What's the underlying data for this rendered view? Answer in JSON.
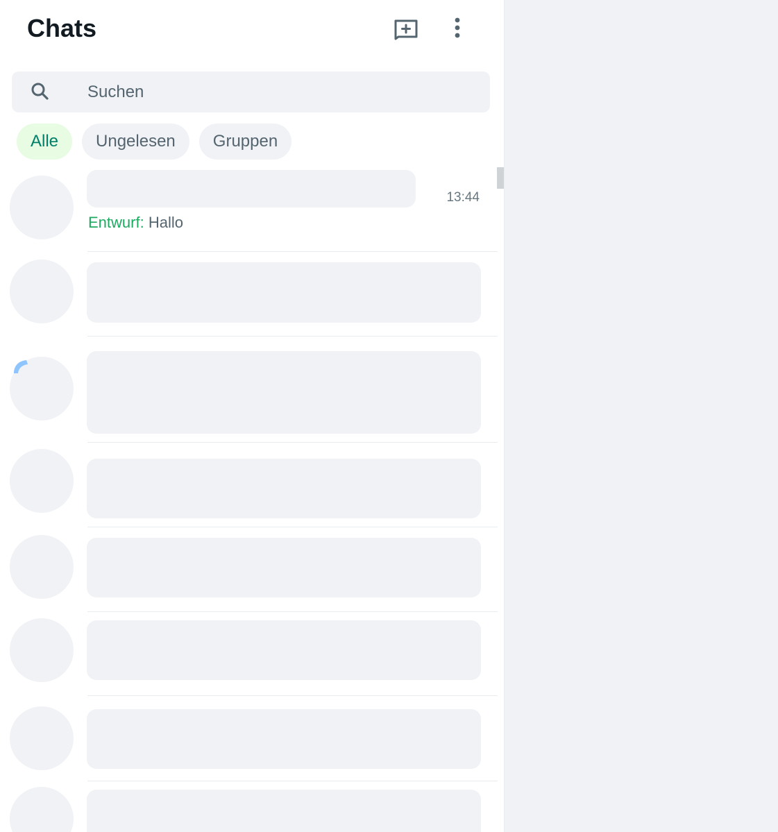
{
  "header": {
    "title": "Chats",
    "new_chat_icon": "new-chat-icon",
    "menu_icon": "more-vertical-icon"
  },
  "search": {
    "placeholder": "Suchen",
    "value": "",
    "icon": "search-icon"
  },
  "filters": [
    {
      "label": "Alle",
      "active": true
    },
    {
      "label": "Ungelesen",
      "active": false
    },
    {
      "label": "Gruppen",
      "active": false
    }
  ],
  "chats": [
    {
      "time": "13:44",
      "draft_label": "Entwurf:",
      "preview": " Hallo"
    }
  ],
  "colors": {
    "accent": "#008069",
    "draft": "#1daa61",
    "active_chip_bg": "#e7fce3",
    "placeholder_bg": "#f0f2f5",
    "loading_arc": "#8ec5ff"
  }
}
